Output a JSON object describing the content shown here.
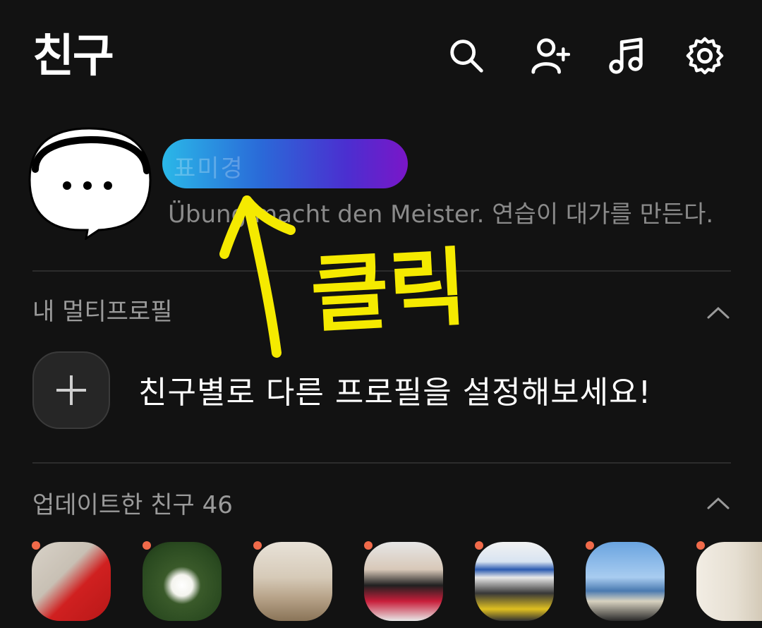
{
  "header": {
    "title": "친구",
    "icons": [
      "search-icon",
      "add-friend-icon",
      "music-icon",
      "settings-icon"
    ]
  },
  "profile": {
    "name": "표미경",
    "status_message": "Übung macht den Meister. 연습이 대가를 만든다.",
    "name_highlight_colors": [
      "#2ab8e8",
      "#7a16c8"
    ]
  },
  "multi_profile": {
    "title": "내 멀티프로필",
    "hint": "친구별로 다른 프로필을 설정해보세요!"
  },
  "updated_friends": {
    "title": "업데이트한 친구 46",
    "count": 46
  },
  "annotation": {
    "text": "클릭",
    "color": "#f5ea00"
  },
  "colors": {
    "background": "#121212",
    "new_dot": "#f06a4a"
  }
}
